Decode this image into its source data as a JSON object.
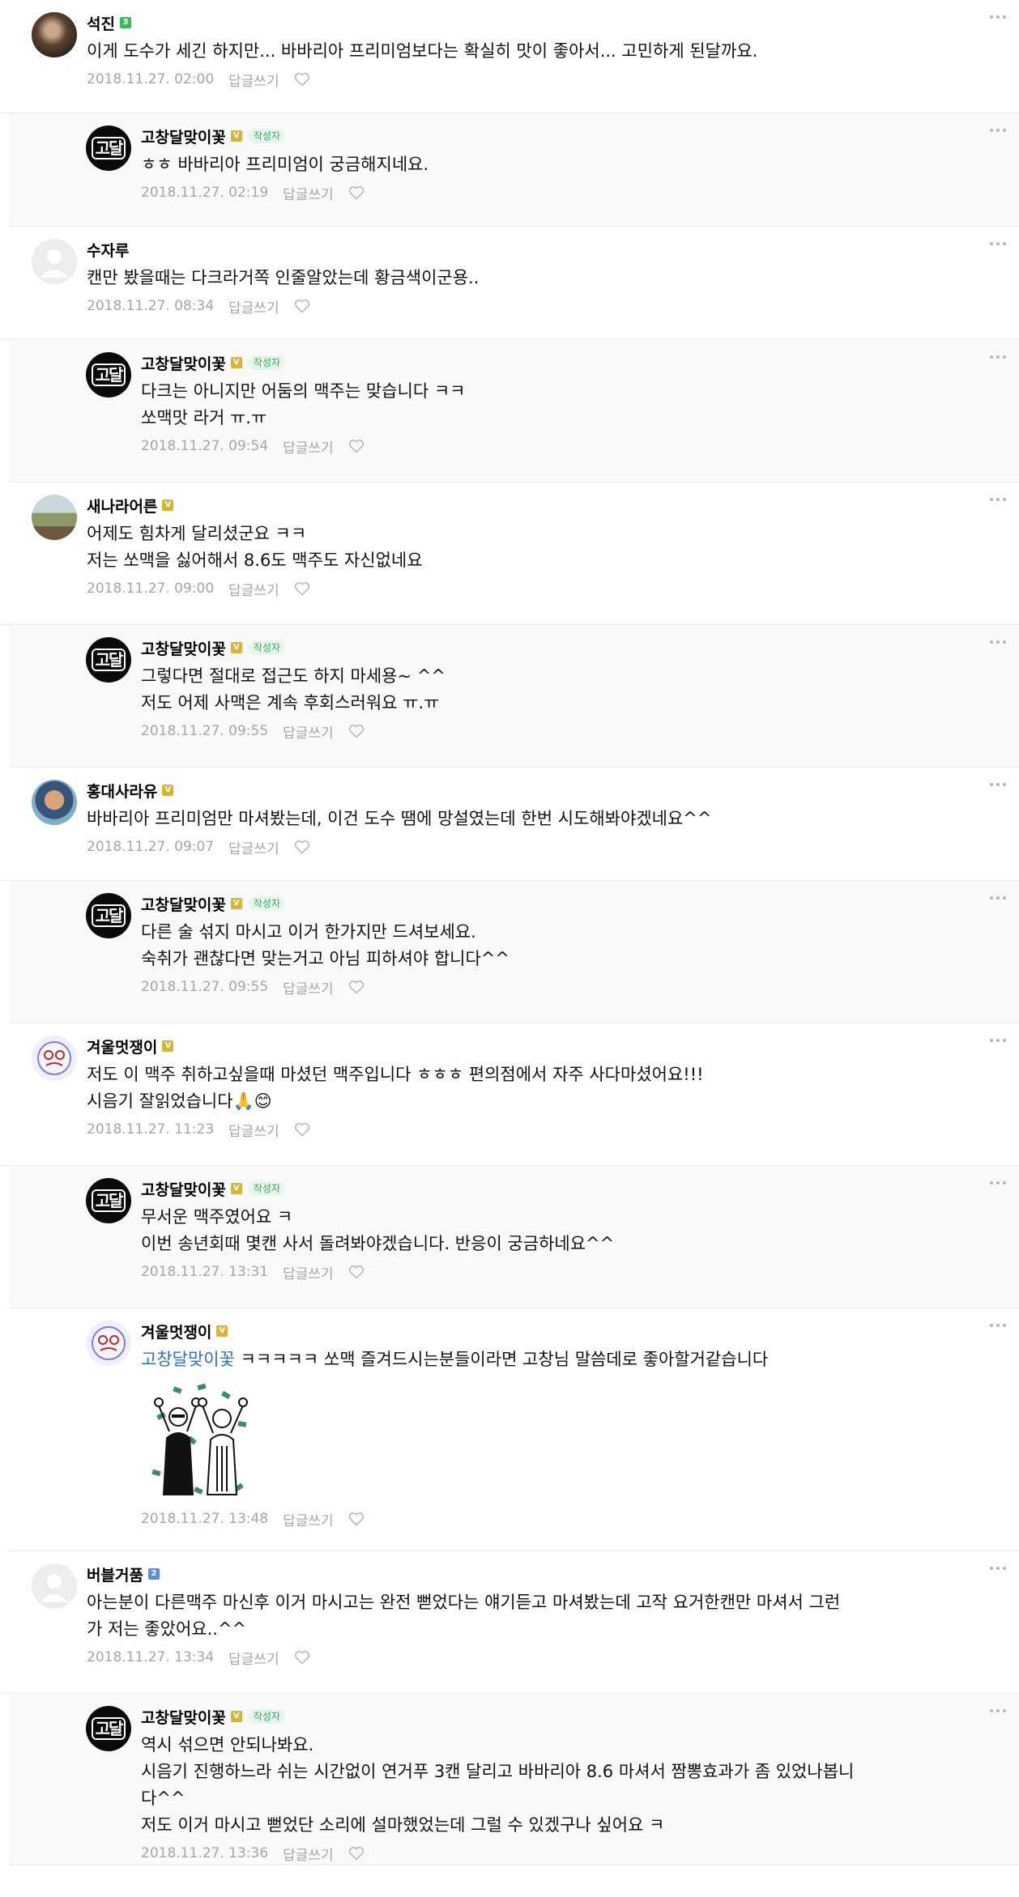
{
  "ui": {
    "reply_label": "답글쓰기",
    "author_label": "작성자"
  },
  "colors": {
    "reply_background": "#f9f9fa",
    "date_text": "#a6a6a6",
    "author_tag_bg": "#e6f6ea",
    "author_tag_text": "#2fae55",
    "mention": "#2b6fd6"
  },
  "comments": [
    {
      "nickname": "석진",
      "badge": "3",
      "text": "이게 도수가 세긴 하지만... 바바리아 프리미엄보다는 확실히 맛이 좋아서... 고민하게 된달까요.",
      "date": "2018.11.27. 02:00"
    },
    {
      "nickname": "고창달맞이꽃",
      "badge": "V",
      "logo_text": "고달",
      "text": "ㅎㅎ 바바리아 프리미엄이 궁금해지네요.",
      "date": "2018.11.27. 02:19"
    },
    {
      "nickname": "수자루",
      "text": "캔만 봤을때는 다크라거쪽 인줄알았는데 황금색이군용..",
      "date": "2018.11.27. 08:34"
    },
    {
      "nickname": "고창달맞이꽃",
      "badge": "V",
      "logo_text": "고달",
      "text": "다크는 아니지만 어둠의 맥주는 맞습니다 ㅋㅋ\n쏘맥맛 라거 ㅠ.ㅠ",
      "date": "2018.11.27. 09:54"
    },
    {
      "nickname": "새나라어른",
      "badge": "V",
      "text": "어제도 힘차게 달리셨군요 ㅋㅋ\n저는 쏘맥을 싫어해서 8.6도 맥주도 자신없네요",
      "date": "2018.11.27. 09:00"
    },
    {
      "nickname": "고창달맞이꽃",
      "badge": "V",
      "logo_text": "고달",
      "text": "그렇다면 절대로 접근도 하지 마세용~ ^^\n저도 어제 사맥은 계속 후회스러워요 ㅠ.ㅠ",
      "date": "2018.11.27. 09:55"
    },
    {
      "nickname": "홍대사라유",
      "badge": "V",
      "text": "바바리아 프리미엄만 마셔봤는데, 이건 도수 땜에 망설였는데 한번 시도해봐야겠네요^^",
      "date": "2018.11.27. 09:07"
    },
    {
      "nickname": "고창달맞이꽃",
      "badge": "V",
      "logo_text": "고달",
      "text": "다른 술 섞지 마시고 이거 한가지만 드셔보세요.\n숙취가 괜찮다면 맞는거고 아님 피하셔야 합니다^^",
      "date": "2018.11.27. 09:55"
    },
    {
      "nickname": "겨울멋쟁이",
      "badge": "V",
      "text": "저도 이 맥주 취하고싶을때 마셨던 맥주입니다 ㅎㅎㅎ 편의점에서 자주 사다마셨어요!!!\n시음기 잘읽었습니다🙏😊",
      "date": "2018.11.27. 11:23"
    },
    {
      "nickname": "고창달맞이꽃",
      "badge": "V",
      "logo_text": "고달",
      "text": "무서운 맥주였어요 ㅋ\n이번 송년회때 몇캔 사서 돌려봐야겠습니다. 반응이 궁금하네요^^",
      "date": "2018.11.27. 13:31"
    },
    {
      "nickname": "겨울멋쟁이",
      "badge": "V",
      "mention": "고창달맞이꽃",
      "text": " ㅋㅋㅋㅋㅋ 쏘맥 즐겨드시는분들이라면 고창님 말씀데로 좋아할거같습니다",
      "date": "2018.11.27. 13:48"
    },
    {
      "nickname": "버블거품",
      "badge": "2",
      "text": "아는분이 다른맥주 마신후 이거 마시고는 완전 뻗었다는 얘기듣고 마셔봤는데 고작 요거한캔만 마셔서 그런\n가 저는 좋았어요..^^",
      "date": "2018.11.27. 13:34"
    },
    {
      "nickname": "고창달맞이꽃",
      "badge": "V",
      "logo_text": "고달",
      "text": "역시 섞으면 안되나봐요.\n시음기 진행하느라 쉬는 시간없이 연거푸 3캔 달리고 바바리아 8.6 마셔서 짬뽕효과가 좀 있었나봅니\n다^^\n저도 이거 마시고 뻗었단 소리에 설마했었는데 그럴 수 있겠구나 싶어요 ㅋ",
      "date": "2018.11.27. 13:36"
    }
  ]
}
